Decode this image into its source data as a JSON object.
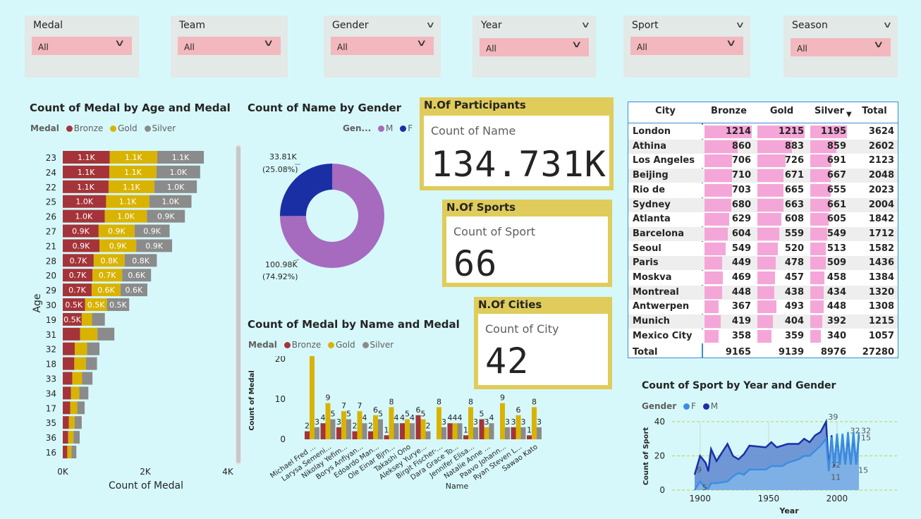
{
  "slicers": [
    {
      "title": "Medal",
      "value": "All",
      "left": 35,
      "width": 162,
      "boxTop": 30,
      "chevron": false
    },
    {
      "title": "Team",
      "value": "All",
      "left": 242,
      "width": 166,
      "boxTop": 30,
      "chevron": false
    },
    {
      "title": "Gender",
      "value": "All",
      "left": 459,
      "width": 166,
      "boxTop": 30,
      "chevron": true
    },
    {
      "title": "Year",
      "value": "All",
      "left": 670,
      "width": 175,
      "boxTop": 32,
      "chevron": true
    },
    {
      "title": "Sport",
      "value": "All",
      "left": 884,
      "width": 180,
      "boxTop": 30,
      "chevron": true
    },
    {
      "title": "Season",
      "value": "All",
      "left": 1111,
      "width": 162,
      "boxTop": 32,
      "chevron": true
    }
  ],
  "age_chart": {
    "title": "Count of Medal by Age and Medal",
    "legend_label": "Medal",
    "xlabel": "Count of Medal",
    "ylabel": "Age",
    "xticks": [
      "0K",
      "2K",
      "4K"
    ]
  },
  "gender_chart": {
    "title": "Count of Name by Gender",
    "legend_label": "Gen...",
    "label_f_value": "33.81K",
    "label_f_pct": "(25.08%)",
    "label_m_value": "100.98K",
    "label_m_pct": "(74.92%)"
  },
  "name_chart": {
    "title": "Count of Medal by Name and Medal",
    "legend_label": "Medal",
    "ylabel": "Count of Medal",
    "xlabel": "Name"
  },
  "year_chart": {
    "title": "Count of Sport by Year and Gender",
    "legend_label": "Gender",
    "ylabel": "Count of Sport",
    "xlabel": "Year"
  },
  "cards": {
    "participants": {
      "header": "N.Of Participants",
      "label": "Count of Name",
      "value": "134.731K"
    },
    "sports": {
      "header": "N.Of Sports",
      "label": "Count of Sport",
      "value": "66"
    },
    "cities": {
      "header": "N.Of Cities",
      "label": "Count of City",
      "value": "42"
    }
  },
  "city_table": {
    "headers": [
      "City",
      "Bronze",
      "Gold",
      "Silver",
      "Total"
    ],
    "rows": [
      [
        "London",
        "1214",
        "1215",
        "1195",
        "3624"
      ],
      [
        "Athina",
        "860",
        "883",
        "859",
        "2602"
      ],
      [
        "Los Angeles",
        "706",
        "726",
        "691",
        "2123"
      ],
      [
        "Beijing",
        "710",
        "671",
        "667",
        "2048"
      ],
      [
        "Rio de Janeiro",
        "703",
        "665",
        "655",
        "2023"
      ],
      [
        "Sydney",
        "680",
        "663",
        "661",
        "2004"
      ],
      [
        "Atlanta",
        "629",
        "608",
        "605",
        "1842"
      ],
      [
        "Barcelona",
        "604",
        "559",
        "549",
        "1712"
      ],
      [
        "Seoul",
        "549",
        "520",
        "513",
        "1582"
      ],
      [
        "Paris",
        "449",
        "478",
        "509",
        "1436"
      ],
      [
        "Moskva",
        "469",
        "457",
        "458",
        "1384"
      ],
      [
        "Montreal",
        "448",
        "438",
        "434",
        "1320"
      ],
      [
        "Antwerpen",
        "367",
        "493",
        "448",
        "1308"
      ],
      [
        "Munich",
        "419",
        "404",
        "392",
        "1215"
      ],
      [
        "Mexico City",
        "358",
        "359",
        "340",
        "1057"
      ]
    ],
    "total": [
      "Total",
      "9165",
      "9139",
      "8976",
      "27280"
    ]
  },
  "colors": {
    "bronze": "#a4343a",
    "gold": "#d9b300",
    "silver": "#8b8b8b",
    "male": "#a66bbe",
    "female": "#1a2fa3",
    "year_f": "#3b8ee0",
    "year_m": "#1b2fa8",
    "databar": "#f5a6d9"
  },
  "chart_data": [
    {
      "type": "bar",
      "orientation": "horizontal",
      "stacked": true,
      "title": "Count of Medal by Age and Medal",
      "xlabel": "Count of Medal",
      "ylabel": "Age",
      "xlim": [
        0,
        4000
      ],
      "xticks": [
        "0K",
        "2K",
        "4K"
      ],
      "categories": [
        "23",
        "24",
        "22",
        "25",
        "26",
        "27",
        "21",
        "28",
        "20",
        "29",
        "30",
        "19",
        "31",
        "32",
        "18",
        "33",
        "34",
        "17",
        "35",
        "36",
        "16"
      ],
      "series": [
        {
          "name": "Bronze",
          "values": [
            1140,
            1130,
            1110,
            1050,
            1020,
            870,
            890,
            750,
            720,
            700,
            540,
            460,
            420,
            290,
            280,
            230,
            200,
            180,
            150,
            130,
            110
          ],
          "labels": [
            "1.1K",
            "1.1K",
            "1.1K",
            "1.0K",
            "1.0K",
            "0.9K",
            "0.9K",
            "0.7K",
            "0.7K",
            "0.7K",
            "0.5K",
            "0.5K",
            "",
            "",
            "",
            "",
            "",
            "",
            "",
            "",
            ""
          ]
        },
        {
          "name": "Gold",
          "values": [
            1150,
            1140,
            1110,
            1050,
            1020,
            870,
            890,
            750,
            720,
            700,
            530,
            250,
            420,
            300,
            280,
            240,
            200,
            170,
            140,
            130,
            100
          ],
          "labels": [
            "1.1K",
            "1.1K",
            "1.1K",
            "1.1K",
            "1.0K",
            "0.9K",
            "0.9K",
            "0.8K",
            "0.7K",
            "0.6K",
            "0.5K",
            "",
            "",
            "",
            "",
            "",
            "",
            "",
            "",
            "",
            ""
          ]
        },
        {
          "name": "Silver",
          "values": [
            1130,
            1060,
            1030,
            1020,
            920,
            850,
            870,
            780,
            700,
            650,
            540,
            310,
            410,
            300,
            270,
            250,
            220,
            180,
            170,
            150,
            120
          ],
          "labels": [
            "1.1K",
            "1.0K",
            "1.0K",
            "1.0K",
            "0.9K",
            "0.9K",
            "0.9K",
            "0.8K",
            "0.6K",
            "0.6K",
            "0.5K",
            "",
            "",
            "",
            "",
            "",
            "",
            "",
            "",
            "",
            ""
          ]
        }
      ],
      "legend": "top-left",
      "grid": false
    },
    {
      "type": "pie",
      "donut": true,
      "title": "Count of Name by Gender",
      "categories": [
        "M",
        "F"
      ],
      "values": [
        100980,
        33810
      ],
      "percent": [
        74.92,
        25.08
      ],
      "legend": "top-right"
    },
    {
      "type": "bar",
      "orientation": "vertical",
      "title": "Count of Medal by Name and Medal",
      "xlabel": "Name",
      "ylabel": "Count of Medal",
      "ylim": [
        0,
        25
      ],
      "yticks": [
        0,
        10,
        20
      ],
      "categories": [
        "Michael Fred ...",
        "Larysa Semeni...",
        "Nikolay Yefim...",
        "Borys Anfiyan...",
        "Edoardo Man...",
        "Ole Einar Bjrn...",
        "Takashi Ono",
        "Aleksey Yurye...",
        "Birgit Fischer-...",
        "Dara Grace To...",
        "Jennifer Elisa...",
        "Natalie Anne ...",
        "Paavo Johann...",
        "Ryan Steven L...",
        "Sawao Kato"
      ],
      "series": [
        {
          "name": "Bronze",
          "values": [
            2,
            4,
            3,
            2,
            2,
            1,
            4,
            6,
            0,
            4,
            1,
            5,
            0,
            3,
            1
          ]
        },
        {
          "name": "Gold",
          "values": [
            23,
            9,
            7,
            7,
            6,
            8,
            5,
            5,
            8,
            4,
            8,
            3,
            9,
            6,
            8
          ]
        },
        {
          "name": "Silver",
          "values": [
            3,
            5,
            5,
            4,
            5,
            4,
            4,
            2,
            3,
            4,
            3,
            4,
            3,
            3,
            3
          ]
        }
      ],
      "legend": "top-left",
      "grid": false
    },
    {
      "type": "area",
      "title": "Count of Sport by Year and Gender",
      "xlabel": "Year",
      "ylabel": "Count of Sport",
      "xlim": [
        1896,
        2016
      ],
      "ylim": [
        0,
        40
      ],
      "xticks": [
        1900,
        1950,
        2000
      ],
      "yticks": [
        0,
        20,
        40
      ],
      "series": [
        {
          "name": "F",
          "x": [
            1896,
            1900,
            1904,
            1906,
            1908,
            1912,
            1920,
            1924,
            1928,
            1932,
            1936,
            1948,
            1952,
            1956,
            1960,
            1964,
            1968,
            1972,
            1976,
            1980,
            1984,
            1988,
            1992,
            1994,
            1996,
            1998,
            2000,
            2002,
            2004,
            2006,
            2008,
            2010,
            2012,
            2014,
            2016
          ],
          "y": [
            0,
            5,
            1,
            1,
            4,
            4,
            5,
            8,
            10,
            9,
            12,
            12,
            14,
            14,
            14,
            16,
            17,
            18,
            20,
            20,
            23,
            26,
            30,
            11,
            31,
            15,
            33,
            15,
            33,
            15,
            34,
            15,
            34,
            15,
            34
          ],
          "labels": {
            "1900": "5",
            "1994": "11",
            "2014": "15",
            "2016": "15"
          }
        },
        {
          "name": "M",
          "x": [
            1896,
            1900,
            1904,
            1906,
            1908,
            1912,
            1920,
            1924,
            1928,
            1932,
            1936,
            1948,
            1952,
            1956,
            1960,
            1964,
            1968,
            1972,
            1976,
            1980,
            1984,
            1988,
            1992,
            1994,
            1996,
            1998,
            2000,
            2002,
            2004,
            2006,
            2008,
            2010,
            2012,
            2014,
            2016
          ],
          "y": [
            9,
            20,
            16,
            11,
            24,
            17,
            27,
            20,
            18,
            21,
            26,
            25,
            28,
            25,
            26,
            27,
            27,
            27,
            30,
            28,
            32,
            34,
            40,
            12,
            32,
            14,
            32,
            15,
            32,
            15,
            32,
            15,
            32,
            15,
            32
          ],
          "labels": {
            "1896": "9",
            "1992": "39",
            "1994": "12",
            "2008": "32",
            "2016": "32"
          }
        }
      ],
      "legend": "top-left",
      "grid": true
    }
  ]
}
